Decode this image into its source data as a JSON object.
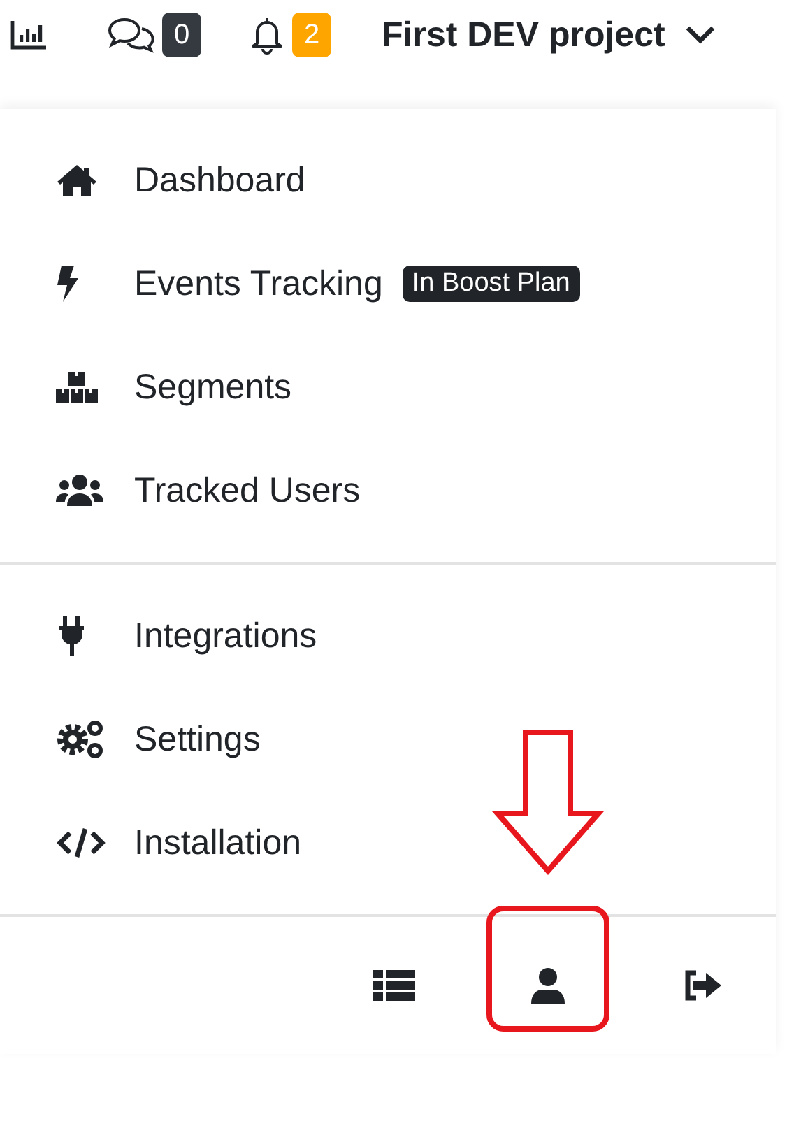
{
  "topbar": {
    "counters": [
      {
        "kind": "chat",
        "count": "0",
        "color": "#343a40"
      },
      {
        "kind": "bell",
        "count": "2",
        "color": "#ffa500"
      }
    ],
    "project": "First DEV project"
  },
  "menu": {
    "sections": [
      {
        "items": [
          {
            "kind": "home",
            "label": "Dashboard"
          },
          {
            "kind": "bolt",
            "label": "Events Tracking",
            "badge": "In Boost Plan"
          },
          {
            "kind": "boxes",
            "label": "Segments"
          },
          {
            "kind": "users",
            "label": "Tracked Users"
          }
        ]
      },
      {
        "items": [
          {
            "kind": "plug",
            "label": "Integrations"
          },
          {
            "kind": "gears",
            "label": "Settings"
          },
          {
            "kind": "code",
            "label": "Installation"
          }
        ]
      }
    ],
    "footer": [
      {
        "kind": "list",
        "highlighted": false
      },
      {
        "kind": "user",
        "highlighted": true
      },
      {
        "kind": "logout",
        "highlighted": false
      }
    ]
  }
}
